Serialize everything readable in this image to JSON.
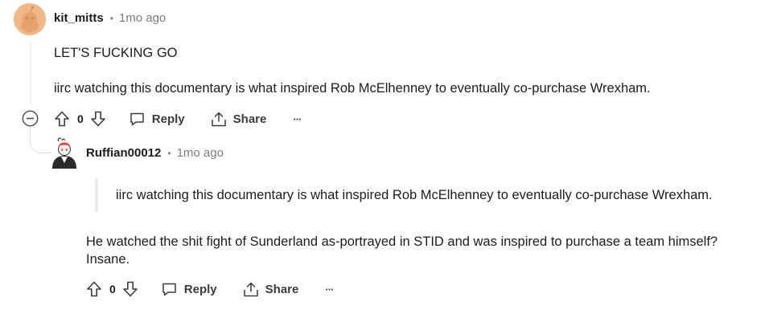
{
  "comments": [
    {
      "username": "kit_mitts",
      "separator": "•",
      "time": "1mo ago",
      "paragraphs": [
        "LET'S FUCKING GO",
        "iirc watching this documentary is what inspired Rob McElhenney to eventually co-purchase Wrexham."
      ],
      "score": "0",
      "reply_label": "Reply",
      "share_label": "Share",
      "more_label": "···",
      "collapse_label": "−",
      "avatar_color": "#f2b786"
    },
    {
      "username": "Ruffian00012",
      "separator": "•",
      "time": "1mo ago",
      "quote": "iirc watching this documentary is what inspired Rob McElhenney to eventually co-purchase Wrexham.",
      "paragraph_lines": [
        "He watched the shit fight of Sunderland as-portrayed in STID and was inspired to purchase a team himself?",
        "Insane."
      ],
      "score": "0",
      "reply_label": "Reply",
      "share_label": "Share",
      "more_label": "···"
    }
  ]
}
